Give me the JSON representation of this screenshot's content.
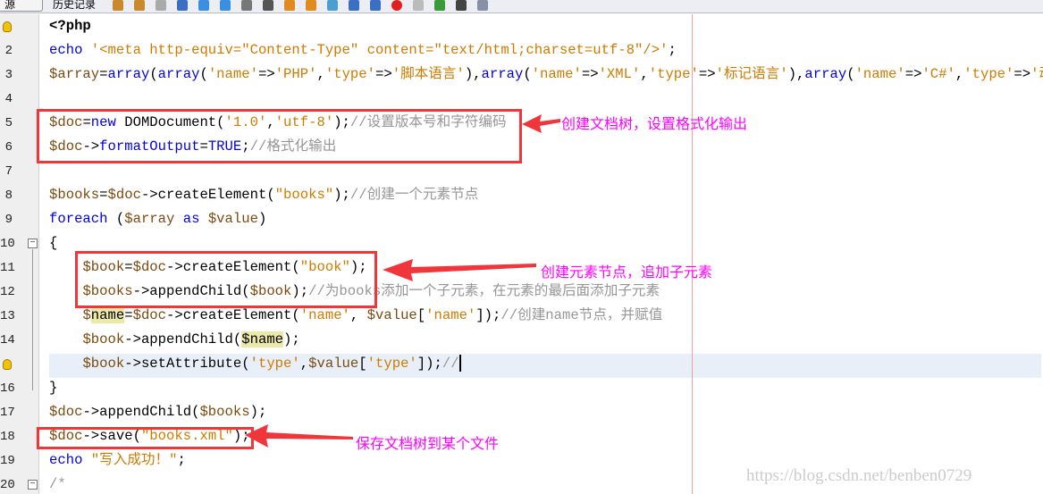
{
  "toolbar": {
    "source_tab": "源",
    "history_tab": "历史记录",
    "icons": [
      "last-edit-icon",
      "back-icon",
      "forward-icon",
      "find-icon",
      "find-prev-icon",
      "find-next-icon",
      "toggle-highlight-icon",
      "toggle-rect-select-icon",
      "prev-bookmark-icon",
      "next-bookmark-icon",
      "toggle-bookmark-icon",
      "shift-left-icon",
      "shift-right-icon",
      "start-macro-icon",
      "stop-macro-icon",
      "comment-icon",
      "uncomment-icon",
      "database-icon"
    ]
  },
  "colors": {
    "keyword": "#0000e6",
    "string": "#ce7b00",
    "comment": "#969696",
    "annotation": "#ff00ff",
    "box": "#f0363a",
    "current_line": "#e9eff8"
  },
  "gutter": {
    "line_numbers": [
      "",
      "2",
      "3",
      "4",
      "5",
      "6",
      "7",
      "8",
      "9",
      "10",
      "11",
      "12",
      "13",
      "14",
      "",
      "16",
      "17",
      "18",
      "19",
      "20"
    ]
  },
  "code": [
    [
      [
        "tag",
        "<?php"
      ]
    ],
    [
      [
        "kw",
        "echo "
      ],
      [
        "str",
        "'<meta http-equiv=\"Content-Type\" content=\"text/html;charset=utf-8\"/>'"
      ],
      [
        "plain",
        ";"
      ]
    ],
    [
      [
        "var",
        "$array"
      ],
      [
        "plain",
        "="
      ],
      [
        "kw",
        "array"
      ],
      [
        "plain",
        "("
      ],
      [
        "kw",
        "array"
      ],
      [
        "plain",
        "("
      ],
      [
        "str",
        "'name'"
      ],
      [
        "plain",
        "=>"
      ],
      [
        "str",
        "'PHP'"
      ],
      [
        "plain",
        ","
      ],
      [
        "str",
        "'type'"
      ],
      [
        "plain",
        "=>"
      ],
      [
        "str",
        "'脚本语言'"
      ],
      [
        "plain",
        "),"
      ],
      [
        "kw",
        "array"
      ],
      [
        "plain",
        "("
      ],
      [
        "str",
        "'name'"
      ],
      [
        "plain",
        "=>"
      ],
      [
        "str",
        "'XML'"
      ],
      [
        "plain",
        ","
      ],
      [
        "str",
        "'type'"
      ],
      [
        "plain",
        "=>"
      ],
      [
        "str",
        "'标记语言'"
      ],
      [
        "plain",
        "),"
      ],
      [
        "kw",
        "array"
      ],
      [
        "plain",
        "("
      ],
      [
        "str",
        "'name'"
      ],
      [
        "plain",
        "=>"
      ],
      [
        "str",
        "'C#'"
      ],
      [
        "plain",
        ","
      ],
      [
        "str",
        "'type'"
      ],
      [
        "plain",
        "=>"
      ],
      [
        "str",
        "'动态"
      ]
    ],
    [],
    [
      [
        "var",
        "$doc"
      ],
      [
        "plain",
        "="
      ],
      [
        "kw",
        "new "
      ],
      [
        "plain",
        "DOMDocument("
      ],
      [
        "str",
        "'1.0'"
      ],
      [
        "plain",
        ","
      ],
      [
        "str",
        "'utf-8'"
      ],
      [
        "plain",
        ");"
      ],
      [
        "cm",
        "//设置版本号和字符编码"
      ]
    ],
    [
      [
        "var",
        "$doc"
      ],
      [
        "plain",
        "->"
      ],
      [
        "kw",
        "formatOutput"
      ],
      [
        "plain",
        "="
      ],
      [
        "kw",
        "TRUE"
      ],
      [
        "plain",
        ";"
      ],
      [
        "cm",
        "//格式化输出"
      ]
    ],
    [],
    [
      [
        "var",
        "$books"
      ],
      [
        "plain",
        "="
      ],
      [
        "var",
        "$doc"
      ],
      [
        "plain",
        "->createElement("
      ],
      [
        "str",
        "\"books\""
      ],
      [
        "plain",
        ");"
      ],
      [
        "cm",
        "//创建一个元素节点"
      ]
    ],
    [
      [
        "kw",
        "foreach "
      ],
      [
        "plain",
        "("
      ],
      [
        "var",
        "$array"
      ],
      [
        "kw",
        " as "
      ],
      [
        "var",
        "$value"
      ],
      [
        "plain",
        ")"
      ]
    ],
    [
      [
        "plain",
        "{"
      ]
    ],
    [
      [
        "plain",
        "    "
      ],
      [
        "var",
        "$book"
      ],
      [
        "plain",
        "="
      ],
      [
        "var",
        "$doc"
      ],
      [
        "plain",
        "->createElement("
      ],
      [
        "str",
        "\"book\""
      ],
      [
        "plain",
        ");"
      ]
    ],
    [
      [
        "plain",
        "    "
      ],
      [
        "var",
        "$books"
      ],
      [
        "plain",
        "->appendChild("
      ],
      [
        "var",
        "$book"
      ],
      [
        "plain",
        ");"
      ],
      [
        "cm",
        "//为books添加一个子元素，在元素的最后面添加子元素"
      ]
    ],
    [
      [
        "plain",
        "    "
      ],
      [
        "var",
        "$"
      ],
      [
        "mark",
        "name"
      ],
      [
        "plain",
        "="
      ],
      [
        "var",
        "$doc"
      ],
      [
        "plain",
        "->createElement("
      ],
      [
        "str",
        "'name'"
      ],
      [
        "plain",
        ", "
      ],
      [
        "var",
        "$value"
      ],
      [
        "plain",
        "["
      ],
      [
        "str",
        "'name'"
      ],
      [
        "plain",
        "]);"
      ],
      [
        "cm",
        "//创建name节点，并赋值"
      ]
    ],
    [
      [
        "plain",
        "    "
      ],
      [
        "var",
        "$book"
      ],
      [
        "plain",
        "->appendChild("
      ],
      [
        "mark",
        "$name"
      ],
      [
        "plain",
        ");"
      ]
    ],
    [
      [
        "plain",
        "    "
      ],
      [
        "var",
        "$book"
      ],
      [
        "plain",
        "->setAttribute("
      ],
      [
        "str",
        "'type'"
      ],
      [
        "plain",
        ","
      ],
      [
        "var",
        "$value"
      ],
      [
        "plain",
        "["
      ],
      [
        "str",
        "'type'"
      ],
      [
        "plain",
        "]);"
      ],
      [
        "cm",
        "//"
      ]
    ],
    [
      [
        "plain",
        "}"
      ]
    ],
    [
      [
        "var",
        "$doc"
      ],
      [
        "plain",
        "->appendChild("
      ],
      [
        "var",
        "$books"
      ],
      [
        "plain",
        ");"
      ]
    ],
    [
      [
        "var",
        "$doc"
      ],
      [
        "plain",
        "->save("
      ],
      [
        "str",
        "\"books.xml\""
      ],
      [
        "plain",
        ");"
      ]
    ],
    [
      [
        "kw",
        "echo "
      ],
      [
        "str",
        "\"写入成功！\""
      ],
      [
        "plain",
        ";"
      ]
    ],
    [
      [
        "cm",
        "/*"
      ]
    ]
  ],
  "annotations": [
    {
      "text": "创建文档树，设置格式化输出"
    },
    {
      "text": "创建元素节点，追加子元素"
    },
    {
      "text": "保存文档树到某个文件"
    }
  ],
  "watermark": "https://blog.csdn.net/benben0729"
}
